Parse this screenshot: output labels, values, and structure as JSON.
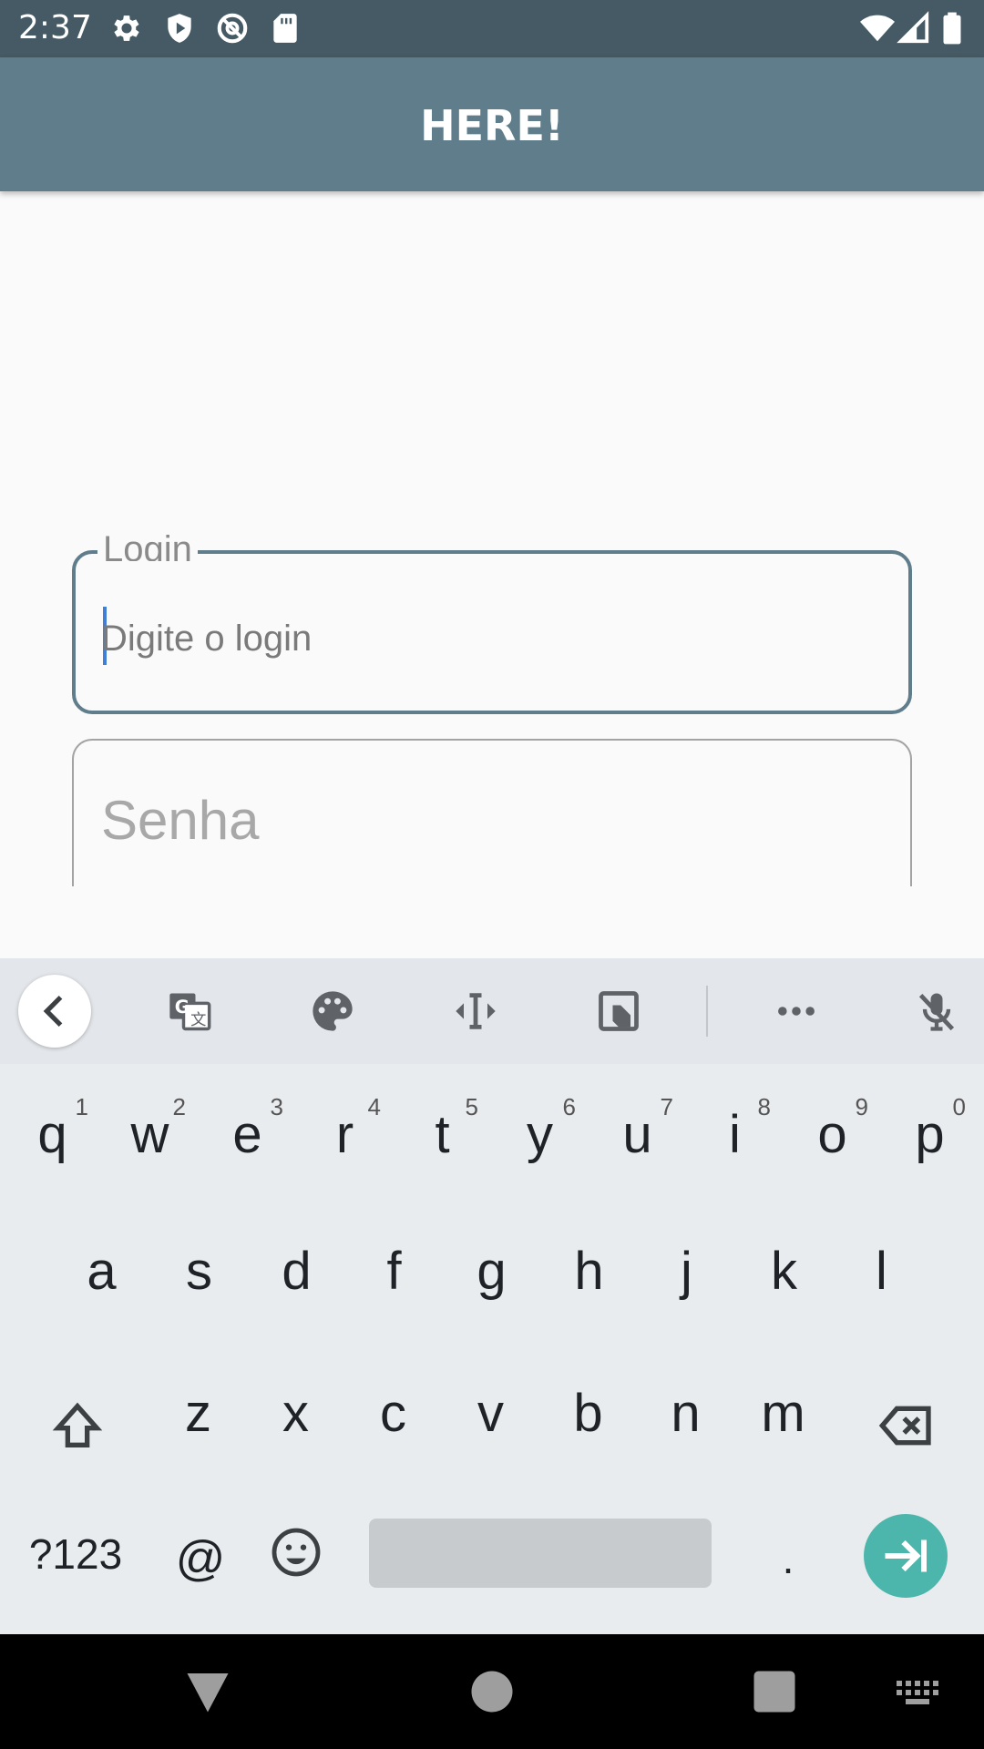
{
  "status_bar": {
    "time": "2:37",
    "icons": [
      "gear-icon",
      "shield-icon",
      "at-sign-icon",
      "sd-card-icon",
      "wifi-icon",
      "signal-icon",
      "battery-icon"
    ]
  },
  "app_bar": {
    "title": "HERE!"
  },
  "form": {
    "login": {
      "label": "Login",
      "placeholder": "Digite o login"
    },
    "senha": {
      "placeholder": "Senha"
    }
  },
  "keyboard": {
    "toolbar": [
      "back-icon",
      "translate-icon",
      "palette-icon",
      "text-cursor-icon",
      "screenshot-icon",
      "more-icon",
      "mic-off-icon"
    ],
    "row1": [
      {
        "ch": "q",
        "hint": "1"
      },
      {
        "ch": "w",
        "hint": "2"
      },
      {
        "ch": "e",
        "hint": "3"
      },
      {
        "ch": "r",
        "hint": "4"
      },
      {
        "ch": "t",
        "hint": "5"
      },
      {
        "ch": "y",
        "hint": "6"
      },
      {
        "ch": "u",
        "hint": "7"
      },
      {
        "ch": "i",
        "hint": "8"
      },
      {
        "ch": "o",
        "hint": "9"
      },
      {
        "ch": "p",
        "hint": "0"
      }
    ],
    "row2": [
      "a",
      "s",
      "d",
      "f",
      "g",
      "h",
      "j",
      "k",
      "l"
    ],
    "row3": [
      "z",
      "x",
      "c",
      "v",
      "b",
      "n",
      "m"
    ],
    "row4": {
      "symbols": "?123",
      "at": "@",
      "period": "."
    }
  },
  "colors": {
    "status_bar": "#455a64",
    "app_bar": "#607d8b",
    "field_focus": "#607d8b",
    "enter_key": "#4db6ac"
  }
}
